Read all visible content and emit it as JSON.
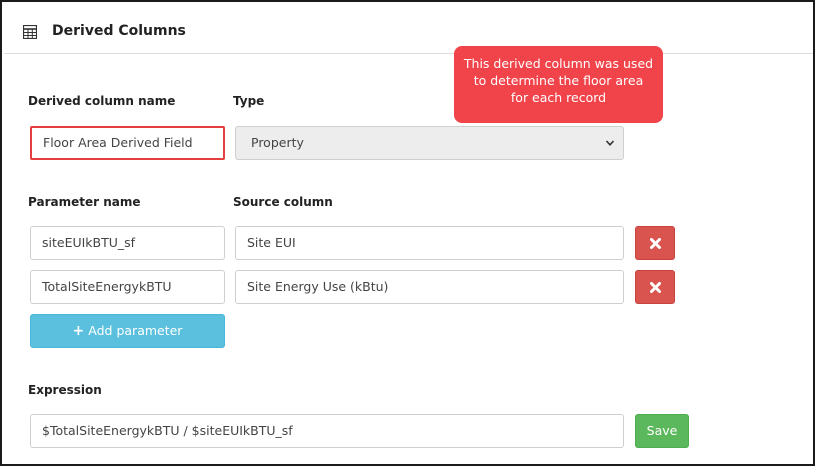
{
  "header": {
    "title": "Derived Columns",
    "icon": "table-grid-icon"
  },
  "derived": {
    "name_label": "Derived column name",
    "name_value": "Floor Area Derived Field",
    "type_label": "Type",
    "type_value": "Property"
  },
  "parameters": {
    "param_label": "Parameter name",
    "source_label": "Source column",
    "rows": [
      {
        "name": "siteEUIkBTU_sf",
        "source": "Site EUI"
      },
      {
        "name": "TotalSiteEnergykBTU",
        "source": "Site Energy Use (kBtu)"
      }
    ],
    "add_label": "Add parameter"
  },
  "expression": {
    "label": "Expression",
    "value": "$TotalSiteEnergykBTU / $siteEUIkBTU_sf",
    "save_label": "Save"
  },
  "callout": {
    "line1": "This derived column was used",
    "line2": "to determine the floor area",
    "line3": "for each record"
  },
  "colors": {
    "callout": "#f0434a",
    "delete": "#d9534f",
    "add": "#5bc0de",
    "save": "#5cb85c",
    "highlight": "#e53e3e"
  }
}
